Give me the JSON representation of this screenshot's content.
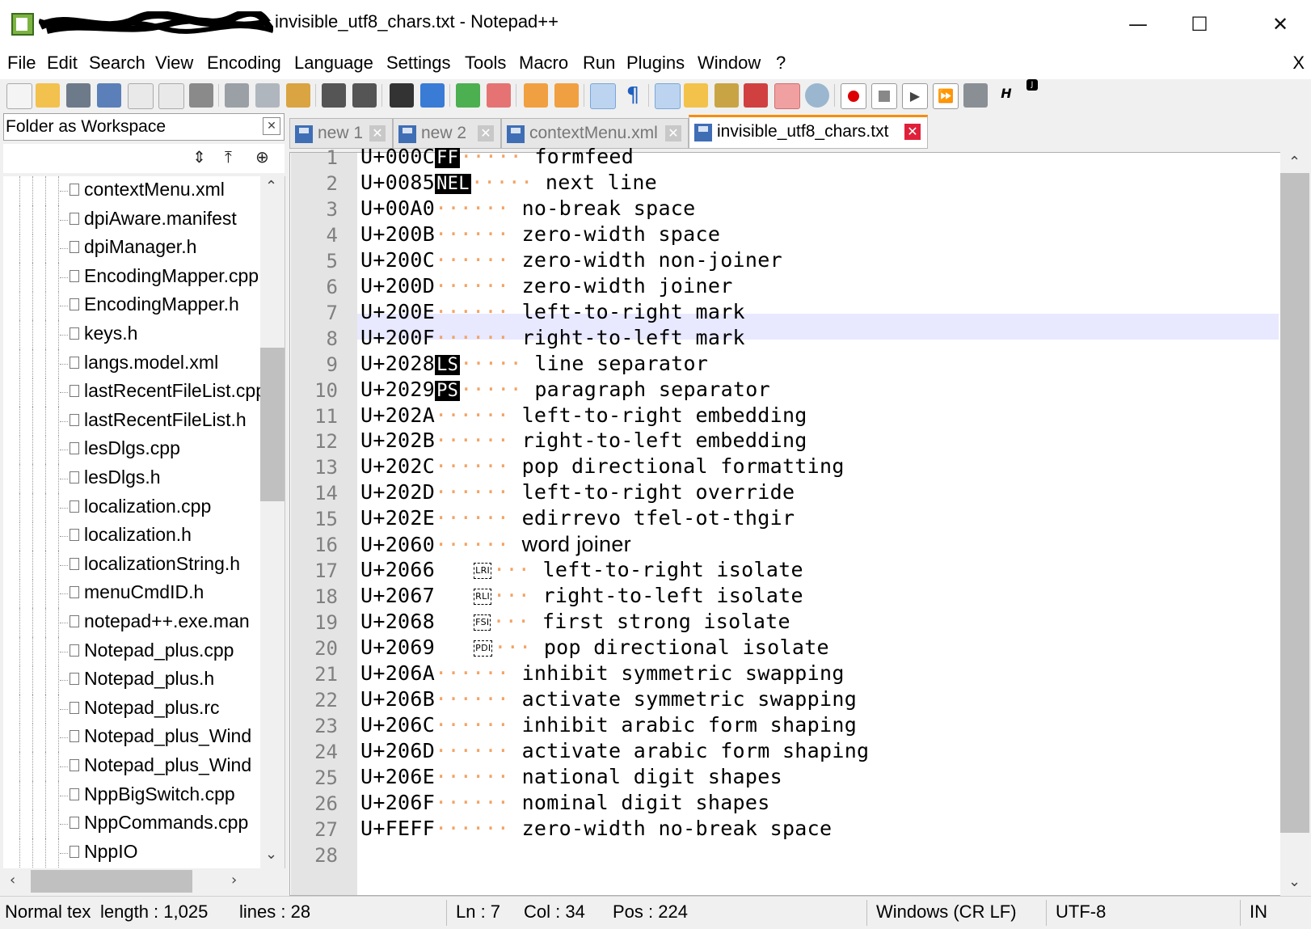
{
  "window": {
    "title": "invisible_utf8_chars.txt - Notepad++",
    "minimize": "—",
    "maximize": "☐",
    "close": "✕"
  },
  "menu": [
    "File",
    "Edit",
    "Search",
    "View",
    "Encoding",
    "Language",
    "Settings",
    "Tools",
    "Macro",
    "Run",
    "Plugins",
    "Window",
    "?"
  ],
  "menu_close": "X",
  "panel": {
    "title": "Folder as Workspace",
    "close": "✕",
    "files": [
      "contextMenu.xml",
      "dpiAware.manifest",
      "dpiManager.h",
      "EncodingMapper.cpp",
      "EncodingMapper.h",
      "keys.h",
      "langs.model.xml",
      "lastRecentFileList.cpp",
      "lastRecentFileList.h",
      "lesDlgs.cpp",
      "lesDlgs.h",
      "localization.cpp",
      "localization.h",
      "localizationString.h",
      "menuCmdID.h",
      "notepad++.exe.man",
      "Notepad_plus.cpp",
      "Notepad_plus.h",
      "Notepad_plus.rc",
      "Notepad_plus_Wind",
      "Notepad_plus_Wind",
      "NppBigSwitch.cpp",
      "NppCommands.cpp",
      "NppIO"
    ]
  },
  "tabs": [
    {
      "label": "new 1",
      "active": false
    },
    {
      "label": "new 2",
      "active": false
    },
    {
      "label": "contextMenu.xml",
      "active": false
    },
    {
      "label": "invisible_utf8_chars.txt",
      "active": true
    }
  ],
  "editor": {
    "current_line": 7,
    "lines": [
      {
        "n": "1",
        "code": "U+000C",
        "marker": "FF",
        "text": "formfeed"
      },
      {
        "n": "2",
        "code": "U+0085",
        "marker": "NEL",
        "text": "next line"
      },
      {
        "n": "3",
        "code": "U+00A0",
        "text": "no-break space"
      },
      {
        "n": "4",
        "code": "U+200B",
        "text": "zero-width space"
      },
      {
        "n": "5",
        "code": "U+200C",
        "text": "zero-width non-joiner"
      },
      {
        "n": "6",
        "code": "U+200D",
        "text": "zero-width joiner"
      },
      {
        "n": "7",
        "code": "U+200E",
        "text": "left-to-right mark"
      },
      {
        "n": "8",
        "code": "U+200F",
        "text": "right-to-left mark"
      },
      {
        "n": "9",
        "code": "U+2028",
        "marker": "LS",
        "text": "line separator"
      },
      {
        "n": "10",
        "code": "U+2029",
        "marker": "PS",
        "text": "paragraph separator"
      },
      {
        "n": "11",
        "code": "U+202A",
        "text": "left-to-right embedding"
      },
      {
        "n": "12",
        "code": "U+202B",
        "text": "right-to-left embedding"
      },
      {
        "n": "13",
        "code": "U+202C",
        "text": "pop directional formatting"
      },
      {
        "n": "14",
        "code": "U+202D",
        "text": "left-to-right override"
      },
      {
        "n": "15",
        "code": "U+202E",
        "text": "edirrevo tfel-ot-thgir"
      },
      {
        "n": "16",
        "code": "U+2060",
        "text": "word joiner"
      },
      {
        "n": "17",
        "code": "U+2066",
        "boxmark": "LRI",
        "text": "left-to-right isolate"
      },
      {
        "n": "18",
        "code": "U+2067",
        "boxmark": "RLI",
        "text": "right-to-left isolate"
      },
      {
        "n": "19",
        "code": "U+2068",
        "boxmark": "FSI",
        "text": "first strong isolate"
      },
      {
        "n": "20",
        "code": "U+2069",
        "boxmark": "PDI",
        "text": "pop directional isolate"
      },
      {
        "n": "21",
        "code": "U+206A",
        "text": "inhibit symmetric swapping"
      },
      {
        "n": "22",
        "code": "U+206B",
        "text": "activate symmetric swapping"
      },
      {
        "n": "23",
        "code": "U+206C",
        "text": "inhibit arabic form shaping"
      },
      {
        "n": "24",
        "code": "U+206D",
        "text": "activate arabic form shaping"
      },
      {
        "n": "25",
        "code": "U+206E",
        "text": "national digit shapes"
      },
      {
        "n": "26",
        "code": "U+206F",
        "text": "nominal digit shapes"
      },
      {
        "n": "27",
        "code": "U+FEFF",
        "text": "zero-width no-break space"
      },
      {
        "n": "28",
        "code": "",
        "text": ""
      }
    ]
  },
  "status": {
    "filetype": "Normal tex",
    "length": "length : 1,025",
    "lines": "lines : 28",
    "ln": "Ln : 7",
    "col": "Col : 34",
    "pos": "Pos : 224",
    "eol": "Windows (CR LF)",
    "encoding": "UTF-8",
    "mode": "IN"
  },
  "colors": {
    "tab_active_accent": "#fa8c00",
    "tab_close": "#e0203a",
    "whitespace_dot": "#f2a365",
    "current_line_bg": "#e8e8ff"
  }
}
